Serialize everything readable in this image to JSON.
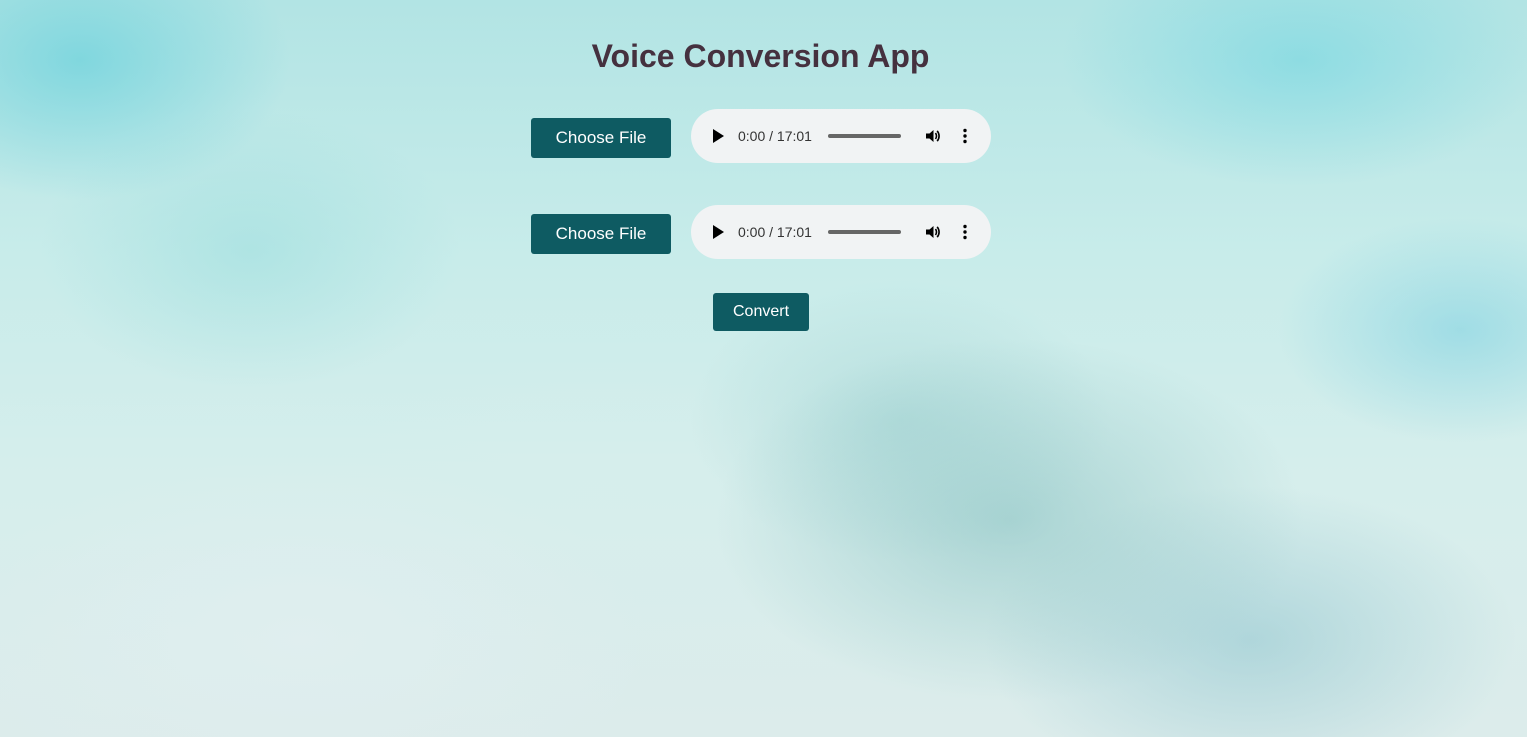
{
  "page": {
    "title": "Voice Conversion App"
  },
  "inputs": [
    {
      "choose_label": "Choose File",
      "player": {
        "time": "0:00 / 17:01",
        "play_icon": "play-icon",
        "volume_icon": "volume-icon",
        "more_icon": "more-options-icon"
      }
    },
    {
      "choose_label": "Choose File",
      "player": {
        "time": "0:00 / 17:01",
        "play_icon": "play-icon",
        "volume_icon": "volume-icon",
        "more_icon": "more-options-icon"
      }
    }
  ],
  "actions": {
    "convert_label": "Convert"
  },
  "colors": {
    "button_bg": "#0e5b62",
    "button_text": "#ffffff",
    "title_text": "#45313f",
    "player_bg": "#f1f3f4"
  }
}
